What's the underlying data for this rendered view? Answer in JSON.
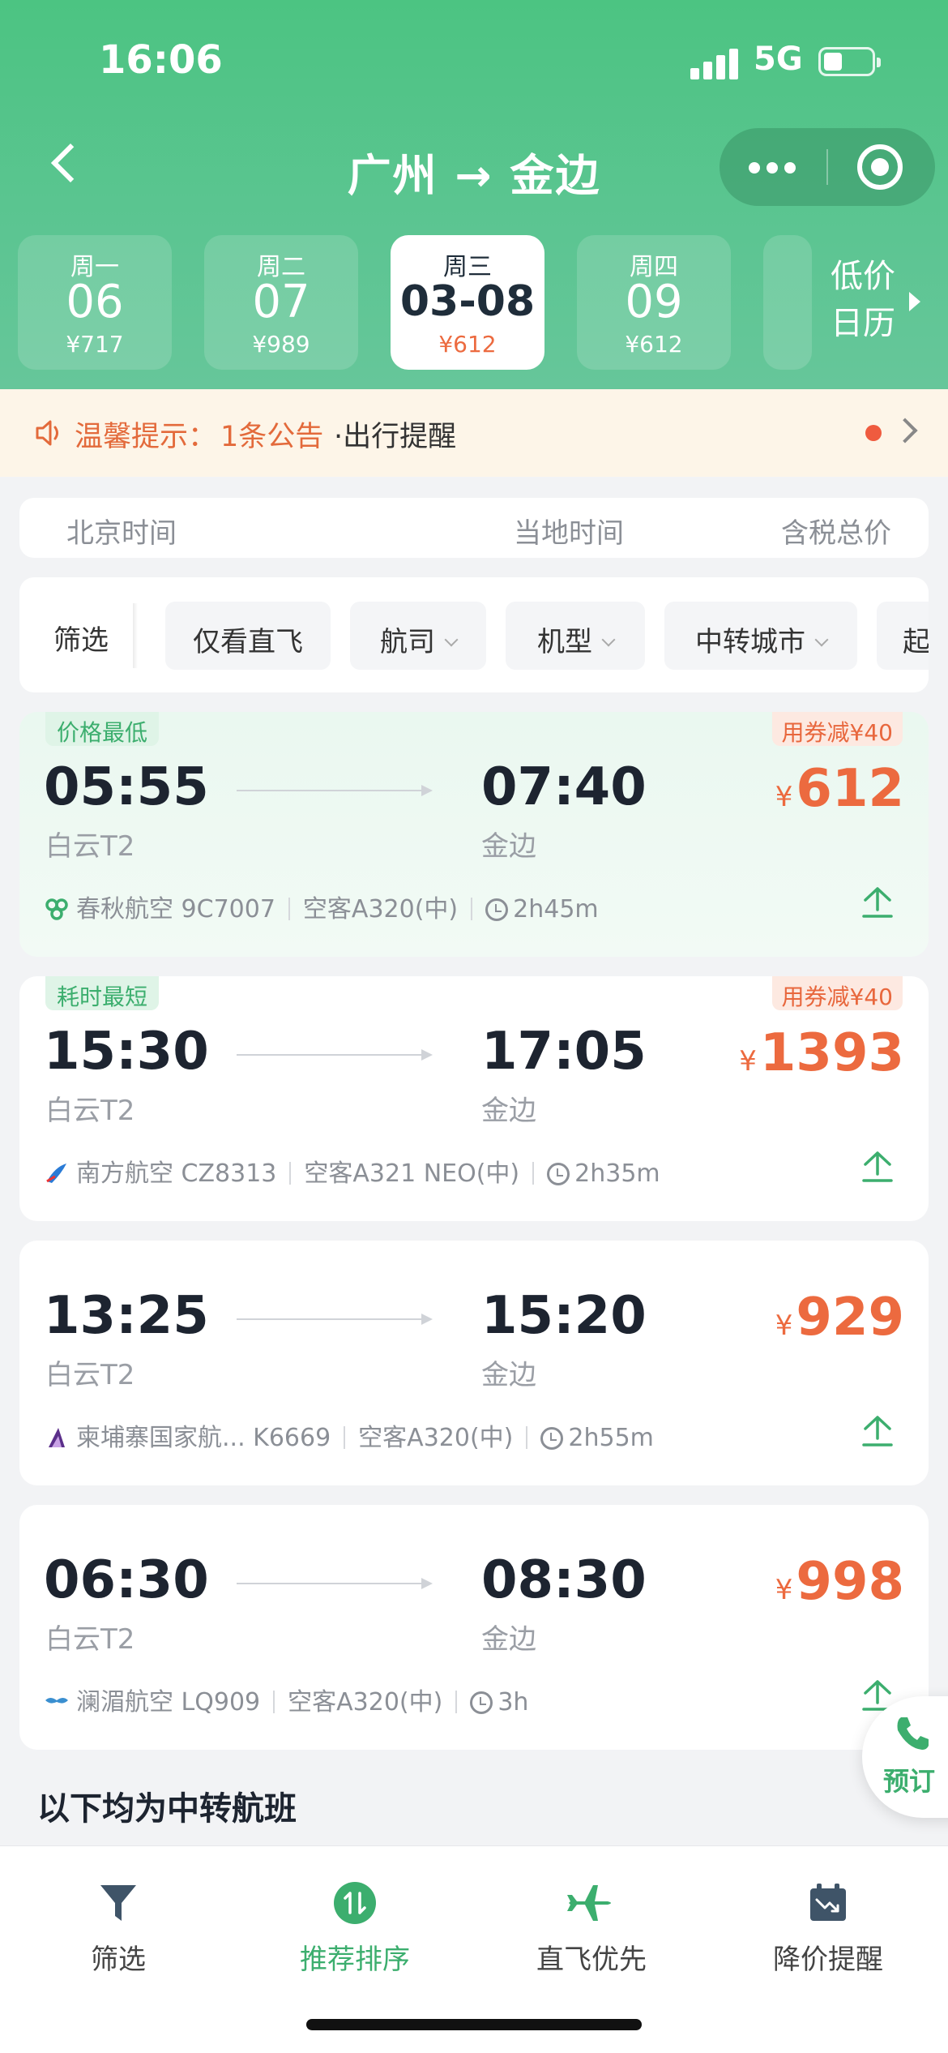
{
  "status": {
    "time": "16:06",
    "network": "5G"
  },
  "header": {
    "title": "广州 → 金边"
  },
  "dates": [
    {
      "weekday": "周一",
      "day": "06",
      "price": "¥717"
    },
    {
      "weekday": "周二",
      "day": "07",
      "price": "¥989"
    },
    {
      "weekday": "周三",
      "day": "03-08",
      "price": "¥612",
      "selected": true
    },
    {
      "weekday": "周四",
      "day": "09",
      "price": "¥612"
    }
  ],
  "calendar": {
    "line1": "低价",
    "line2": "日历"
  },
  "notice": {
    "label": "温馨提示：",
    "link": "1条公告",
    "sub": "·出行提醒"
  },
  "columns": {
    "beijing": "北京时间",
    "local": "当地时间",
    "total": "含税总价"
  },
  "filters": {
    "main": "筛选",
    "chips": [
      "仅看直飞",
      "航司",
      "机型",
      "中转城市",
      "起"
    ]
  },
  "flights": [
    {
      "tag": "价格最低",
      "coupon": "用券减¥40",
      "dep_time": "05:55",
      "arr_time": "07:40",
      "dep_airport": "白云T2",
      "arr_airport": "金边",
      "currency": "¥",
      "price": "612",
      "airline": "春秋航空 9C7007",
      "aircraft": "空客A320(中)",
      "duration": "2h45m",
      "icon": "spring-airlines-icon",
      "icon_color": "#3cae6e"
    },
    {
      "tag": "耗时最短",
      "coupon": "用券减¥40",
      "dep_time": "15:30",
      "arr_time": "17:05",
      "dep_airport": "白云T2",
      "arr_airport": "金边",
      "currency": "¥",
      "price": "1393",
      "airline": "南方航空 CZ8313",
      "aircraft": "空客A321 NEO(中)",
      "duration": "2h35m",
      "icon": "china-southern-icon",
      "icon_color": "#2a7bd6"
    },
    {
      "tag": "",
      "coupon": "",
      "dep_time": "13:25",
      "arr_time": "15:20",
      "dep_airport": "白云T2",
      "arr_airport": "金边",
      "currency": "¥",
      "price": "929",
      "airline": "柬埔寨国家航... K6669",
      "aircraft": "空客A320(中)",
      "duration": "2h55m",
      "icon": "cambodia-angkor-icon",
      "icon_color": "#5b2f8a"
    },
    {
      "tag": "",
      "coupon": "",
      "dep_time": "06:30",
      "arr_time": "08:30",
      "dep_airport": "白云T2",
      "arr_airport": "金边",
      "currency": "¥",
      "price": "998",
      "airline": "澜湄航空 LQ909",
      "aircraft": "空客A320(中)",
      "duration": "3h",
      "icon": "lanmei-airlines-icon",
      "icon_color": "#3a8fd0"
    }
  ],
  "transfer_title": "以下均为中转航班",
  "book": {
    "label": "预订"
  },
  "tabs": [
    {
      "label": "筛选",
      "icon": "filter-icon"
    },
    {
      "label": "推荐排序",
      "icon": "sort-icon",
      "active": true
    },
    {
      "label": "直飞优先",
      "icon": "plane-icon"
    },
    {
      "label": "降价提醒",
      "icon": "price-drop-calendar-icon"
    }
  ],
  "colors": {
    "brand": "#3cae6e",
    "price": "#ec6a3f",
    "header": "#5cc592"
  }
}
